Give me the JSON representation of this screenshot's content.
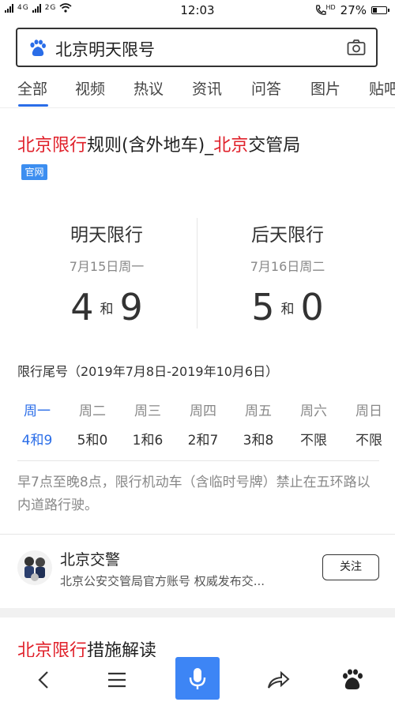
{
  "status_bar": {
    "signal_left": "4G",
    "signal_right": "2G",
    "time": "12:03",
    "hd_label": "HD",
    "battery": "27%",
    "battery_level": 0.27
  },
  "search": {
    "query": "北京明天限号"
  },
  "tabs": [
    {
      "label": "全部",
      "active": true
    },
    {
      "label": "视频",
      "active": false
    },
    {
      "label": "热议",
      "active": false
    },
    {
      "label": "资讯",
      "active": false
    },
    {
      "label": "问答",
      "active": false
    },
    {
      "label": "图片",
      "active": false
    },
    {
      "label": "贴吧",
      "active": false
    }
  ],
  "result": {
    "title_hl1": "北京限行",
    "title_mid": "规则(含外地车)_",
    "title_hl2": "北京",
    "title_end": "交管局",
    "badge": "官网"
  },
  "days": [
    {
      "title": "明天限行",
      "date": "7月15日周一",
      "num1": "4",
      "and": "和",
      "num2": "9"
    },
    {
      "title": "后天限行",
      "date": "7月16日周二",
      "num1": "5",
      "and": "和",
      "num2": "0"
    }
  ],
  "period": "限行尾号（2019年7月8日-2019年10月6日）",
  "week": [
    {
      "day": "周一",
      "nums": "4和9",
      "today": true
    },
    {
      "day": "周二",
      "nums": "5和0",
      "today": false
    },
    {
      "day": "周三",
      "nums": "1和6",
      "today": false
    },
    {
      "day": "周四",
      "nums": "2和7",
      "today": false
    },
    {
      "day": "周五",
      "nums": "3和8",
      "today": false
    },
    {
      "day": "周六",
      "nums": "不限",
      "today": false
    },
    {
      "day": "周日",
      "nums": "不限",
      "today": false
    }
  ],
  "rule": "早7点至晚8点，限行机动车（含临时号牌）禁止在五环路以内道路行驶。",
  "account": {
    "name": "北京交警",
    "desc": "北京公安交管局官方账号 权威发布交...",
    "follow": "关注"
  },
  "next_result": {
    "title_hl": "北京限行",
    "title_rest": "措施解读"
  },
  "colors": {
    "accent": "#2a6de8",
    "highlight": "#e0202a",
    "mic": "#3d85f5"
  }
}
